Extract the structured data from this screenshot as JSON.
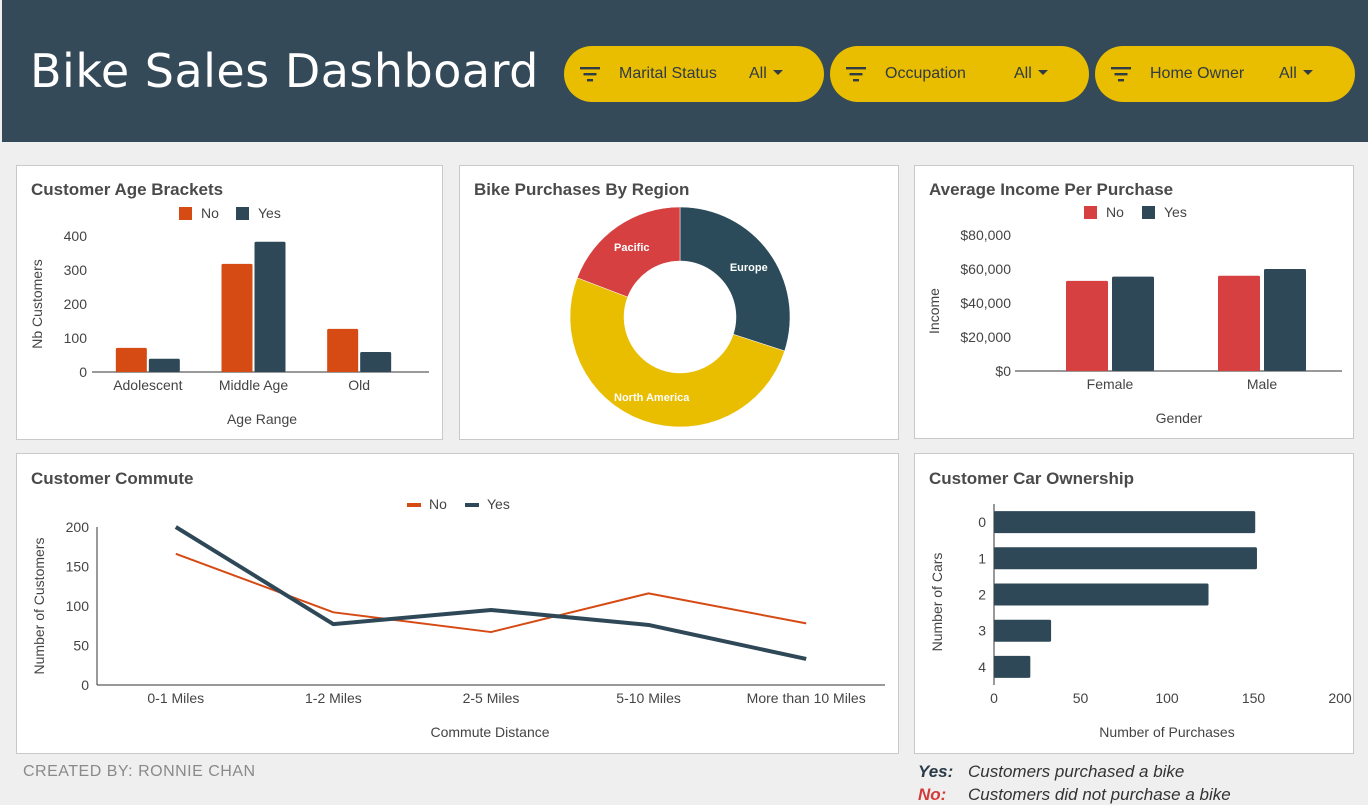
{
  "dashboard": {
    "title": "Bike Sales Dashboard",
    "credit": "CREATED BY: RONNIE CHAN"
  },
  "filters": [
    {
      "label": "Marital Status",
      "value": "All"
    },
    {
      "label": "Occupation",
      "value": "All"
    },
    {
      "label": "Home Owner",
      "value": "All"
    }
  ],
  "legend_notes": [
    {
      "key": "Yes:",
      "text": "Customers purchased a bike",
      "color": "#2b3a48"
    },
    {
      "key": "No:",
      "text": "Customers did not purchase a bike",
      "color": "#d33a3a"
    }
  ],
  "colors": {
    "header": "#344a59",
    "filter": "#e9bd00",
    "no_orange": "#d64a14",
    "yes_navy": "#2f4858",
    "no_red": "#d64040",
    "europe": "#2b4b5a",
    "north_america": "#e9bd00",
    "pacific": "#d64040"
  },
  "chart_data": [
    {
      "id": "age",
      "type": "bar",
      "title": "Customer Age Brackets",
      "categories": [
        "Adolescent",
        "Middle Age",
        "Old"
      ],
      "series": [
        {
          "name": "No",
          "values": [
            71,
            318,
            127
          ],
          "color": "#d64a14"
        },
        {
          "name": "Yes",
          "values": [
            39,
            383,
            59
          ],
          "color": "#2f4858"
        }
      ],
      "xlabel": "Age Range",
      "ylabel": "Nb Customers",
      "ylim": [
        0,
        400
      ],
      "yticks": [
        "0",
        "100",
        "200",
        "300",
        "400"
      ],
      "legend_position": "top"
    },
    {
      "id": "region",
      "type": "pie",
      "title": "Bike Purchases By Region",
      "donut": true,
      "slices": [
        {
          "label": "Europe",
          "value": 300,
          "color": "#2b4b5a"
        },
        {
          "label": "North America",
          "value": 508,
          "color": "#e9bd00"
        },
        {
          "label": "Pacific",
          "value": 192,
          "color": "#d64040"
        }
      ]
    },
    {
      "id": "income",
      "type": "bar",
      "title": "Average Income Per Purchase",
      "categories": [
        "Female",
        "Male"
      ],
      "series": [
        {
          "name": "No",
          "values": [
            53000,
            56000
          ],
          "color": "#d64040"
        },
        {
          "name": "Yes",
          "values": [
            55500,
            60000
          ],
          "color": "#2f4858"
        }
      ],
      "xlabel": "Gender",
      "ylabel": "Income",
      "ylim": [
        0,
        80000
      ],
      "yticks": [
        "$0",
        "$20,000",
        "$40,000",
        "$60,000",
        "$80,000"
      ],
      "legend_position": "top"
    },
    {
      "id": "commute",
      "type": "line",
      "title": "Customer Commute",
      "categories": [
        "0-1 Miles",
        "1-2 Miles",
        "2-5 Miles",
        "5-10 Miles",
        "More than 10 Miles"
      ],
      "series": [
        {
          "name": "No",
          "values": [
            166,
            92,
            67,
            116,
            78
          ],
          "color": "#d64a14"
        },
        {
          "name": "Yes",
          "values": [
            200,
            77,
            95,
            76,
            33
          ],
          "color": "#2f4858"
        }
      ],
      "xlabel": "Commute Distance",
      "ylabel": "Number of Customers",
      "ylim": [
        0,
        200
      ],
      "yticks": [
        "0",
        "50",
        "100",
        "150",
        "200"
      ],
      "legend_position": "top"
    },
    {
      "id": "cars",
      "type": "bar",
      "orientation": "horizontal",
      "title": "Customer Car Ownership",
      "categories": [
        "0",
        "1",
        "2",
        "3",
        "4"
      ],
      "values": [
        151,
        152,
        124,
        33,
        21
      ],
      "color": "#2f4858",
      "xlabel": "Number of Purchases",
      "ylabel": "Number of Cars",
      "xlim": [
        0,
        200
      ],
      "xticks": [
        "0",
        "50",
        "100",
        "150",
        "200"
      ]
    }
  ]
}
